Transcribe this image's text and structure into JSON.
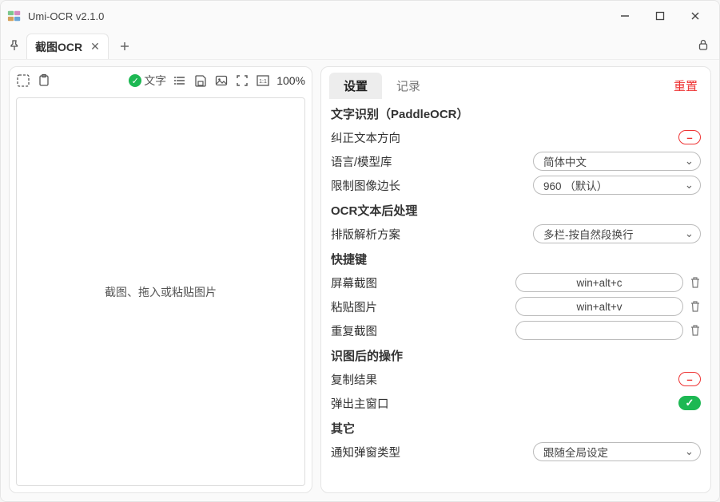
{
  "window": {
    "title": "Umi-OCR v2.1.0"
  },
  "tabs": {
    "active": "截图OCR"
  },
  "left": {
    "status_label": "文字",
    "zoom": "100%",
    "drop_hint": "截图、拖入或粘贴图片"
  },
  "right": {
    "tabs": {
      "settings": "设置",
      "records": "记录"
    },
    "reset": "重置",
    "sections": {
      "engine_title": "文字识别（PaddleOCR）",
      "correct_dir": "纠正文本方向",
      "lang_label": "语言/模型库",
      "lang_value": "简体中文",
      "limit_label": "限制图像边长",
      "limit_value": "960 （默认）",
      "post_title": "OCR文本后处理",
      "layout_label": "排版解析方案",
      "layout_value": "多栏-按自然段换行",
      "hotkeys_title": "快捷键",
      "hk_screenshot_label": "屏幕截图",
      "hk_screenshot_value": "win+alt+c",
      "hk_paste_label": "粘贴图片",
      "hk_paste_value": "win+alt+v",
      "hk_repeat_label": "重复截图",
      "hk_repeat_value": "",
      "after_title": "识图后的操作",
      "copy_label": "复制结果",
      "popup_label": "弹出主窗口",
      "other_title": "其它",
      "notify_label": "通知弹窗类型",
      "notify_value": "跟随全局设定"
    }
  }
}
